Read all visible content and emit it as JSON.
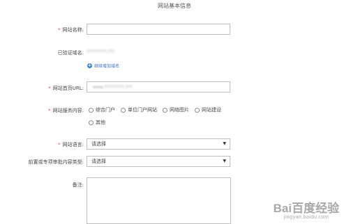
{
  "page_title": "网站基本信息",
  "fields": {
    "site_name": {
      "required_mark": "*",
      "label": "网站名称:",
      "value": ""
    },
    "verified_domain": {
      "label": "已验证域名:",
      "value": "?????????.???"
    },
    "add_domain": {
      "label": "继续增加域名"
    },
    "homepage_url": {
      "required_mark": "*",
      "label": "网站首页URL:",
      "value": "www.?????????.???"
    },
    "service_content": {
      "required_mark": "*",
      "label": "网站服务内容:",
      "options": [
        "综合门户",
        "单位门户网站",
        "网络图片",
        "网站建设",
        "其他"
      ]
    },
    "site_language": {
      "required_mark": "*",
      "label": "网站语言:",
      "selected": "请选择"
    },
    "pre_approval_type": {
      "label": "前置或专项审批内容类型:",
      "selected": "请选择"
    },
    "remarks": {
      "label": "备注:",
      "value": ""
    }
  },
  "watermark": {
    "main": "Bai百度经验",
    "sub": "jingyan.baidu.com"
  },
  "icons": {
    "add": "plus-circle-icon",
    "dropdown": "caret-down-icon"
  },
  "colors": {
    "required": "#e2463f",
    "link": "#3b74c5"
  }
}
